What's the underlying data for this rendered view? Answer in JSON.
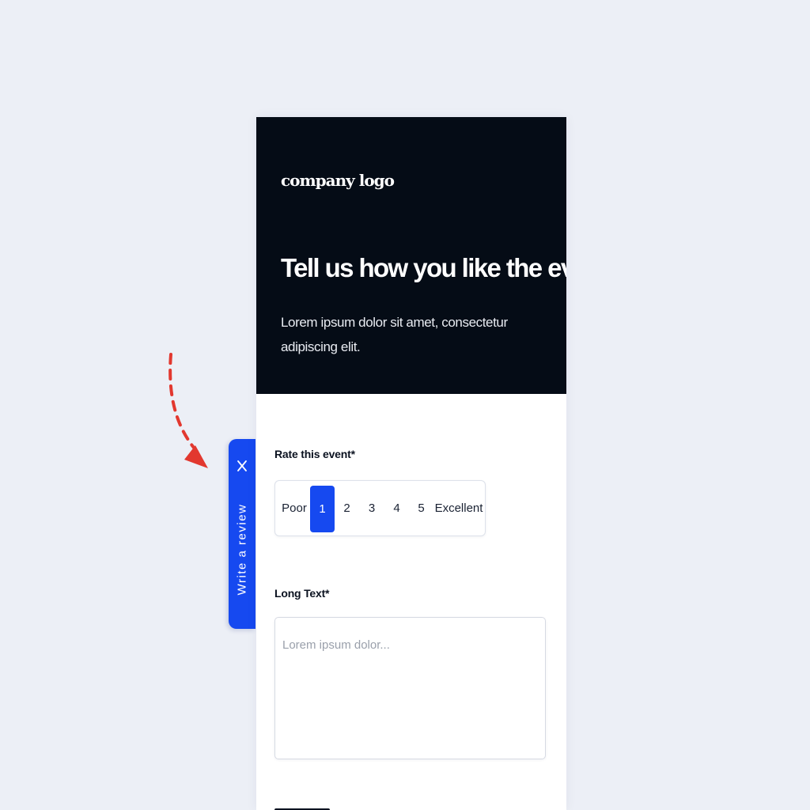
{
  "side_tab": {
    "label": "Write a review",
    "close_icon": "close-icon"
  },
  "arrow": {
    "color": "#e2382f",
    "icon": "curved-dashed-arrow-icon"
  },
  "hero": {
    "logo_text": "company logo",
    "title": "Tell us how you like the event",
    "subtitle": "Lorem ipsum dolor sit amet, consectetur adipiscing elit."
  },
  "rating_field": {
    "label": "Rate this event*",
    "low_label": "Poor",
    "high_label": "Excellent",
    "options": [
      "1",
      "2",
      "3",
      "4",
      "5"
    ],
    "selected": "1"
  },
  "long_text_field": {
    "label": "Long Text*",
    "placeholder": "Lorem ipsum dolor...",
    "value": ""
  },
  "colors": {
    "accent": "#1649f0",
    "hero_background": "#050c16",
    "page_background": "#eceff6",
    "arrow": "#e2382f"
  }
}
